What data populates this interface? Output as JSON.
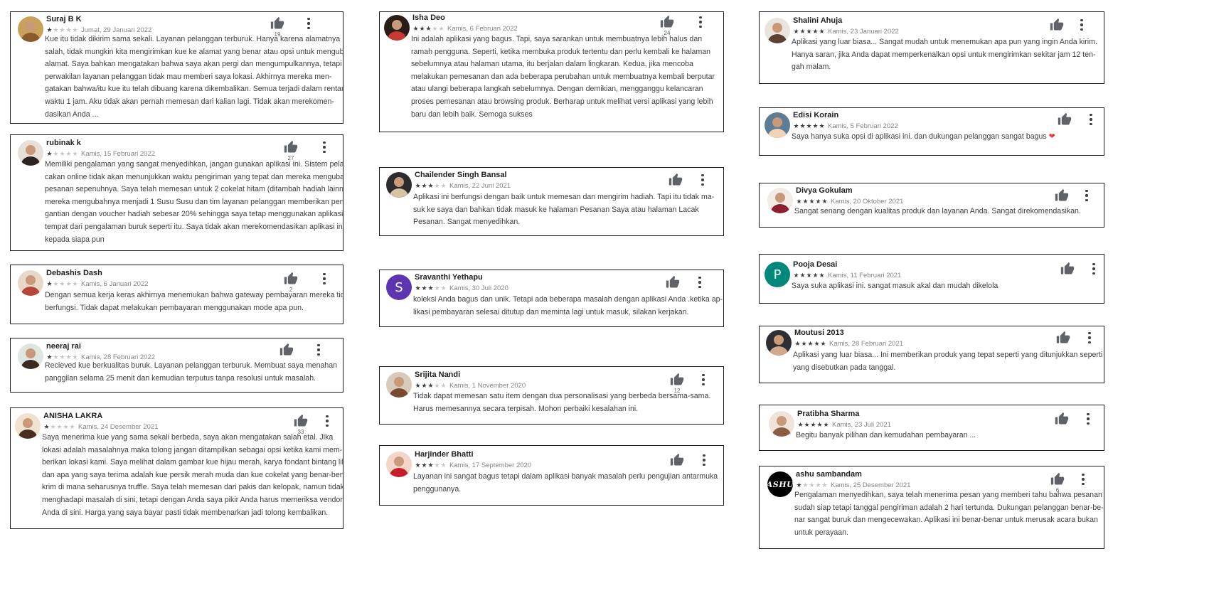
{
  "reviews": [
    {
      "name": "Suraj B K",
      "rating": 1,
      "date": "Jumat, 29 Januari 2022",
      "likes": "19",
      "text": [
        "Kue itu tidak dikirim sama sekali. Layanan pelanggan terburuk. Hanya karena alamatnya",
        "salah, tidak mungkin kita mengirimkan kue ke alamat yang benar atau opsi untuk mengubah",
        "alamat. Saya bahkan mengatakan bahwa saya akan pergi dan mengumpulkannya, tetapi",
        "perwakilan layanan pelanggan tidak mau memberi saya lokasi. Akhirnya mereka men-",
        "gatakan bahwa/itu kue itu telah dibuang karena dikembalikan. Semua terjadi dalam rentang",
        "waktu 1 jam. Aku tidak akan pernah memesan dari kalian lagi. Tidak akan merekomen-",
        "dasikan Anda ..."
      ]
    },
    {
      "name": "rubinak k",
      "rating": 1,
      "date": "Kamis, 15 Februari 2022",
      "likes": "27",
      "text": [
        "Memiliki pengalaman yang sangat menyedihkan, jangan gunakan aplikasi ini. Sistem pela-",
        "cakan online tidak akan menunjukkan waktu pengiriman yang tepat dan mereka mengubah",
        "pesanan sepenuhnya. Saya telah memesan untuk 2 cokelat hitam (ditambah hadiah lainnya)",
        "mereka mengubahnya menjadi 1 Susu Susu dan tim layanan pelanggan memberikan peng-",
        "gantian dengan voucher hadiah sebesar 20% sehingga saya tetap menggunakan aplikasi di",
        "tempat dari pengalaman buruk seperti itu. Saya tidak akan merekomendasikan aplikasi ini",
        "kepada siapa pun"
      ]
    },
    {
      "name": "Debashis Dash",
      "rating": 1,
      "date": "Kamis, 6 Januari 2022",
      "likes": "2",
      "text": [
        "Dengan semua kerja keras akhirnya menemukan bahwa gateway pembayaran mereka tidak",
        "berfungsi. Tidak dapat melakukan pembayaran menggunakan mode apa pun."
      ]
    },
    {
      "name": "neeraj rai",
      "rating": 1,
      "date": "Kamis, 28 Februari 2022",
      "likes": "",
      "text": [
        "Recieved kue berkualitas buruk. Layanan pelanggan terburuk. Membuat saya menahan",
        "panggilan selama 25 menit dan kemudian terputus tanpa resolusi untuk masalah."
      ]
    },
    {
      "name": "ANISHA LAKRA",
      "rating": 1,
      "date": "Kamis, 24 Desember 2021",
      "likes": "33",
      "text": [
        "Saya menerima kue yang sama sekali berbeda, saya akan mengatakan salah etal. Jika",
        "lokasi adalah masalahnya maka tolong jangan ditampilkan sebagai opsi ketika kami mem-",
        "berikan lokasi kami. Saya melihat dalam gambar kue hijau merah, karya fondant bintang lil,",
        "dan apa yang saya terima adalah kue persik merah muda dan kue cokelat yang benar-benar",
        "krim di mana seharusnya truffle. Saya telah memesan dari pakis dan kelopak, namun tidak",
        "menghadapi masalah di sini, tetapi dengan Anda saya pikir Anda harus memeriksa vendor",
        "Anda di sini. Harga yang saya bayar pasti tidak membenarkan jadi tolong kembalikan."
      ]
    },
    {
      "name": "Isha Deo",
      "rating": 3,
      "date": "Kamis, 6 Februari 2022",
      "likes": "24",
      "text": [
        "Ini adalah aplikasi yang bagus. Tapi, saya sarankan untuk membuatnya lebih halus dan",
        "ramah pengguna. Seperti, ketika membuka produk tertentu dan perlu kembali ke halaman",
        "sebelumnya atau halaman utama, itu berjalan dalam lingkaran. Kedua, jika mencoba",
        "melakukan pemesanan dan ada beberapa perubahan untuk membuatnya kembali berputar",
        "atau ulangi beberapa langkah sebelumnya. Dengan demikian, mengganggu kelancaran",
        "proses pemesanan atau browsing produk. Berharap untuk melihat versi aplikasi yang lebih",
        "baru dan lebih baik. Semoga sukses"
      ]
    },
    {
      "name": "Chailender Singh Bansal",
      "rating": 3,
      "date": "Kamis, 22 Juni 2021",
      "likes": "",
      "text": [
        "Aplikasi ini berfungsi dengan baik untuk memesan dan mengirim hadiah. Tapi itu tidak ma-",
        "suk ke saya dan bahkan tidak masuk ke halaman Pesanan Saya atau halaman Lacak",
        "Pesanan. Sangat menyedihkan."
      ]
    },
    {
      "name": "Sravanthi Yethapu",
      "rating": 3,
      "date": "Kamis, 30 Juli 2020",
      "likes": "",
      "initial": "S",
      "text": [
        "koleksi Anda bagus dan unik. Tetapi ada beberapa masalah dengan aplikasi Anda .ketika ap-",
        "likasi pembayaran selesai ditutup dan meminta lagi untuk masuk, silakan kerjakan."
      ]
    },
    {
      "name": "Srijita Nandi",
      "rating": 3,
      "date": "Kamis, 1 November 2020",
      "likes": "12",
      "text": [
        "Tidak dapat memesan satu item dengan dua personalisasi yang berbeda bersama-sama.",
        "Harus memesannya secara terpisah. Mohon perbaiki kesalahan ini."
      ]
    },
    {
      "name": "Harjinder Bhatti",
      "rating": 3,
      "date": "Kamis, 17 September 2020",
      "likes": "",
      "text": [
        "Layanan ini sangat bagus tetapi dalam aplikasi banyak masalah perlu pengujian antarmuka",
        "penggunanya."
      ]
    },
    {
      "name": "Shalini Ahuja",
      "rating": 5,
      "date": "Kamis, 23 Januari 2022",
      "likes": "",
      "text": [
        "Aplikasi yang luar biasa... Sangat mudah untuk menemukan apa pun yang ingin Anda kirim.",
        "Hanya saran, jika Anda dapat memperkenalkan opsi untuk mengirimkan sekitar jam 12 ten-",
        "gah malam."
      ]
    },
    {
      "name": "Edisi Korain",
      "rating": 5,
      "date": "Kamis, 5 Februari 2022",
      "likes": "",
      "heart": "❤",
      "text": [
        "Saya hanya suka opsi di aplikasi ini. dan dukungan pelanggan sangat bagus"
      ]
    },
    {
      "name": "Divya Gokulam",
      "rating": 5,
      "date": "Kamis, 20 Oktober 2021",
      "likes": "",
      "text": [
        "Sangat senang dengan kualitas produk dan layanan Anda. Sangat direkomendasikan."
      ]
    },
    {
      "name": "Pooja Desai",
      "rating": 5,
      "date": "Kamis, 11 Februari 2021",
      "likes": "",
      "initial": "P",
      "text": [
        "Saya suka aplikasi ini. sangat masuk akal dan mudah dikelola"
      ]
    },
    {
      "name": "Moutusi 2013",
      "rating": 5,
      "date": "Kamis, 28 Februari 2021",
      "likes": "",
      "text": [
        "Aplikasi yang luar biasa... Ini memberikan produk yang tepat seperti yang ditunjukkan seperti",
        "yang disebutkan pada tanggal."
      ]
    },
    {
      "name": "Pratibha Sharma",
      "rating": 5,
      "date": "Kamis, 23 Juli 2021",
      "likes": "",
      "text": [
        "Begitu banyak pilihan dan kemudahan pembayaran ..."
      ]
    },
    {
      "name": "ashu sambandam",
      "rating": 1,
      "date": "Kamis, 25 Desember 2021",
      "likes": "6",
      "avatar_word": "ASHU",
      "text": [
        "Pengalaman menyedihkan, saya telah menerima pesan yang memberi tahu bahwa pesanan",
        "sudah siap tetapi tanggal pengiriman adalah 2 hari tertunda. Dukungan pelanggan benar-be-",
        "nar sangat buruk dan mengecewakan. Aplikasi ini benar-benar untuk merusak acara bukan",
        "untuk perayaan."
      ]
    }
  ],
  "colors": {
    "border": "#1a1a1a",
    "star_on": "#3c4043",
    "star_off": "#c6c6c6",
    "heart": "#e53935",
    "avatar_s": "#5e35b1",
    "avatar_p": "#00897b"
  }
}
